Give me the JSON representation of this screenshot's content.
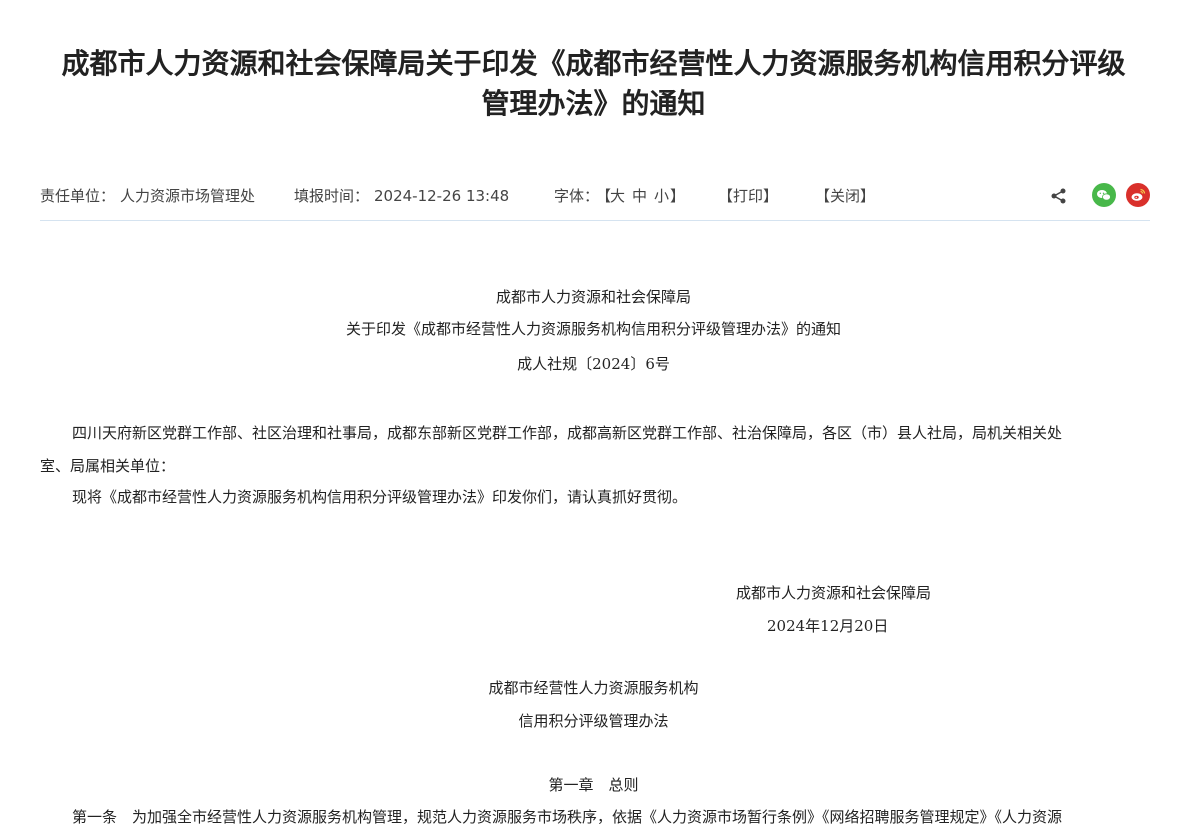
{
  "article": {
    "title_line1": "成都市人力资源和社会保障局关于印发《成都市经营性人力资源服务机构信用积分评级",
    "title_line2": "管理办法》的通知"
  },
  "meta": {
    "unit_label": "责任单位：",
    "unit_value": "人力资源市场管理处",
    "time_label": "填报时间：",
    "time_value": "2024-12-26 13:48",
    "font_label": "字体：",
    "font_open": "【",
    "font_large": "大",
    "font_medium": "中",
    "font_small": "小",
    "font_close": "】",
    "print_label": "【打印】",
    "close_label": "【关闭】"
  },
  "icons": {
    "share": "share-icon",
    "wechat": "wechat-icon",
    "weibo": "weibo-icon"
  },
  "colors": {
    "wechat": "#48b84a",
    "weibo": "#d9302b",
    "divider": "#d5e3f0"
  },
  "body": {
    "issuer": "成都市人力资源和社会保障局",
    "notice_title": "关于印发《成都市经营性人力资源服务机构信用积分评级管理办法》的通知",
    "doc_number": "成人社规〔2024〕6号",
    "recipients_line1": "四川天府新区党群工作部、社区治理和社事局，成都东部新区党群工作部，成都高新区党群工作部、社治保障局，各区（市）县人社局，局机关相关处",
    "recipients_line2": "室、局属相关单位：",
    "instruction": "现将《成都市经营性人力资源服务机构信用积分评级管理办法》印发你们，请认真抓好贯彻。",
    "signature": "成都市人力资源和社会保障局",
    "date": "2024年12月20日",
    "method_title_line1": "成都市经营性人力资源服务机构",
    "method_title_line2": "信用积分评级管理办法",
    "chapter1": "第一章　总则",
    "article1": "第一条　为加强全市经营性人力资源服务机构管理，规范人力资源服务市场秩序，依据《人力资源市场暂行条例》《网络招聘服务管理规定》《人力资源"
  }
}
